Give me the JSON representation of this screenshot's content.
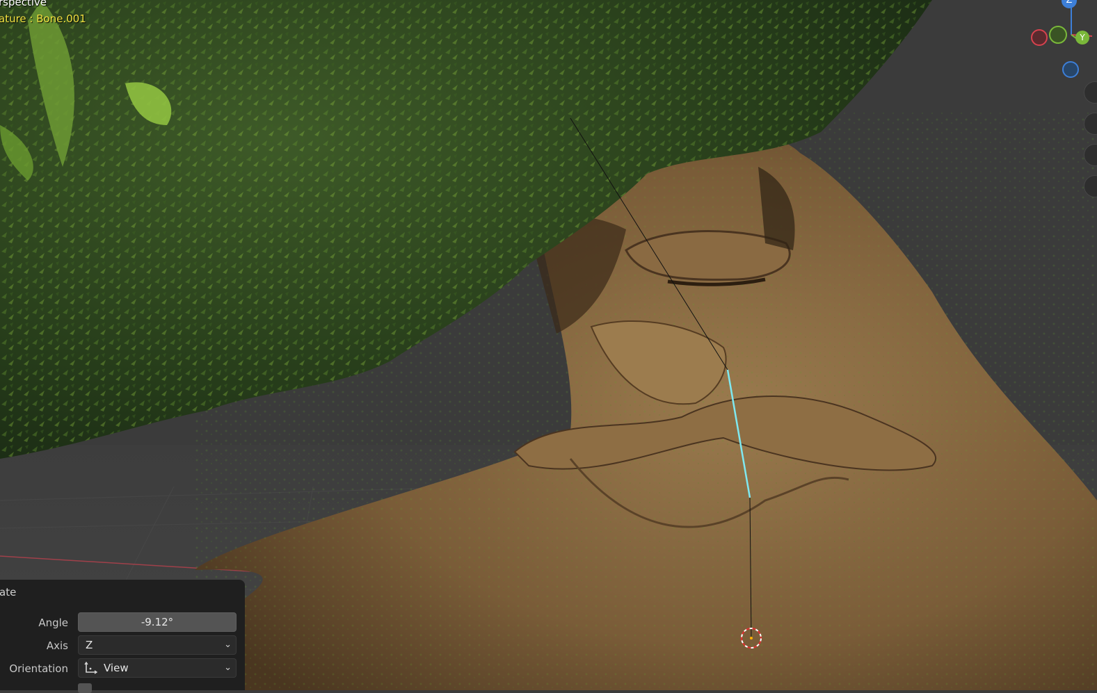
{
  "viewport": {
    "view_name": "rspective",
    "object_info": "ature : Bone.001"
  },
  "gizmo": {
    "z_label": "Z",
    "y_label": "Y",
    "colors": {
      "x": "#d8424e",
      "y": "#7ab83a",
      "z": "#3d7fd8"
    }
  },
  "operator_panel": {
    "title": "ate",
    "angle": {
      "label": "Angle",
      "value": "-9.12°"
    },
    "axis": {
      "label": "Axis",
      "value": "Z"
    },
    "orientation": {
      "label": "Orientation",
      "value": "View",
      "icon": "orientation-axes-icon"
    }
  }
}
